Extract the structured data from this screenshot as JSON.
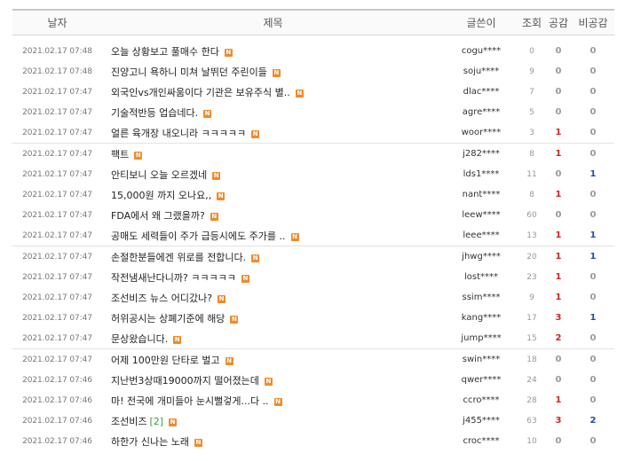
{
  "columns": {
    "date": "날자",
    "title": "제목",
    "writer": "글쓴이",
    "views": "조회",
    "likes": "공감",
    "dislikes": "비공감"
  },
  "colors": {
    "new_badge": "#f08a2c",
    "like": "#d42222",
    "dislike": "#1f4fa0",
    "comment": "#3a9a3a"
  },
  "new_badge_label": "N",
  "posts": [
    {
      "date": "2021.02.17 07:48",
      "title": "오늘 상황보고 풀매수 한다",
      "comments": "",
      "writer": "cogu****",
      "views": "0",
      "likes": "0",
      "dislikes": "0"
    },
    {
      "date": "2021.02.17 07:48",
      "title": "진양고니 욕하니 미쳐 날뛰던 주린이들",
      "comments": "",
      "writer": "soju****",
      "views": "9",
      "likes": "0",
      "dislikes": "0"
    },
    {
      "date": "2021.02.17 07:47",
      "title": "외국인vs개인싸움이다 기관은 보유주식 별..",
      "comments": "",
      "writer": "dlac****",
      "views": "7",
      "likes": "0",
      "dislikes": "0"
    },
    {
      "date": "2021.02.17 07:47",
      "title": "기술적반등 업습네다.",
      "comments": "",
      "writer": "agre****",
      "views": "5",
      "likes": "0",
      "dislikes": "0"
    },
    {
      "date": "2021.02.17 07:47",
      "title": "얼른 육개장 내오니라 ㅋㅋㅋㅋㅋ",
      "comments": "",
      "writer": "woor****",
      "views": "3",
      "likes": "1",
      "dislikes": "0"
    },
    {
      "date": "2021.02.17 07:47",
      "title": "팩트",
      "comments": "",
      "writer": "j282****",
      "views": "8",
      "likes": "1",
      "dislikes": "0"
    },
    {
      "date": "2021.02.17 07:47",
      "title": "안티보니 오늘 오르겠네",
      "comments": "",
      "writer": "lds1****",
      "views": "11",
      "likes": "0",
      "dislikes": "1"
    },
    {
      "date": "2021.02.17 07:47",
      "title": "15,000원 까지 오나요,,",
      "comments": "",
      "writer": "nant****",
      "views": "8",
      "likes": "1",
      "dislikes": "0"
    },
    {
      "date": "2021.02.17 07:47",
      "title": "FDA에서 왜 그랬을까?",
      "comments": "",
      "writer": "leew****",
      "views": "60",
      "likes": "0",
      "dislikes": "0"
    },
    {
      "date": "2021.02.17 07:47",
      "title": "공매도 세력들이 주가 급등시에도 주가를 ..",
      "comments": "",
      "writer": "leee****",
      "views": "13",
      "likes": "1",
      "dislikes": "1"
    },
    {
      "date": "2021.02.17 07:47",
      "title": "손절한분들에겐 위로를 전합니다.",
      "comments": "",
      "writer": "jhwg****",
      "views": "20",
      "likes": "1",
      "dislikes": "1"
    },
    {
      "date": "2021.02.17 07:47",
      "title": "작전냄새난다니까? ㅋㅋㅋㅋㅋ",
      "comments": "",
      "writer": "lost****",
      "views": "23",
      "likes": "1",
      "dislikes": "0"
    },
    {
      "date": "2021.02.17 07:47",
      "title": "조선비즈 뉴스 어디갔나?",
      "comments": "",
      "writer": "ssim****",
      "views": "9",
      "likes": "1",
      "dislikes": "0"
    },
    {
      "date": "2021.02.17 07:47",
      "title": "허위공시는 상폐기준에 해당",
      "comments": "",
      "writer": "kang****",
      "views": "17",
      "likes": "3",
      "dislikes": "1"
    },
    {
      "date": "2021.02.17 07:47",
      "title": "문상왔습니다.",
      "comments": "",
      "writer": "jump****",
      "views": "15",
      "likes": "2",
      "dislikes": "0"
    },
    {
      "date": "2021.02.17 07:47",
      "title": "어제 100만원 단타로 벌고",
      "comments": "",
      "writer": "swin****",
      "views": "18",
      "likes": "0",
      "dislikes": "0"
    },
    {
      "date": "2021.02.17 07:46",
      "title": "지난번3상때19000까지 떨어졌는데",
      "comments": "",
      "writer": "qwer****",
      "views": "24",
      "likes": "0",
      "dislikes": "0"
    },
    {
      "date": "2021.02.17 07:46",
      "title": "마! 전국에 개미들아 눈시뻘겋게...다 ..",
      "comments": "",
      "writer": "ccro****",
      "views": "28",
      "likes": "1",
      "dislikes": "0"
    },
    {
      "date": "2021.02.17 07:46",
      "title": "조선비즈",
      "comments": "[2]",
      "writer": "j455****",
      "views": "63",
      "likes": "3",
      "dislikes": "2"
    },
    {
      "date": "2021.02.17 07:46",
      "title": "하한가 신나는 노래",
      "comments": "",
      "writer": "croc****",
      "views": "10",
      "likes": "0",
      "dislikes": "0"
    }
  ]
}
